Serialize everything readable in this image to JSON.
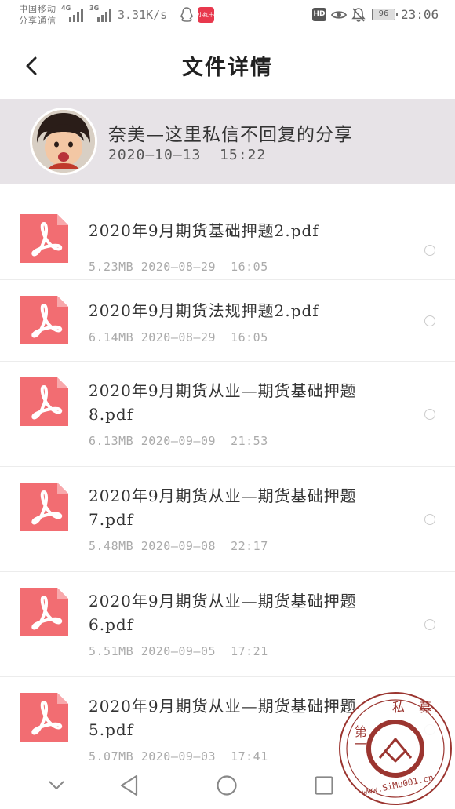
{
  "status_bar": {
    "carrier_line1": "中国移动",
    "carrier_line2": "分享通信",
    "net1": "4G",
    "net2": "3G",
    "speed": "3.31K/s",
    "app_badge": "小红书",
    "hd": "HD",
    "battery": "96",
    "time": "23:06"
  },
  "header": {
    "title": "文件详情"
  },
  "sharer": {
    "name": "奈美—这里私信不回复的分享",
    "time": "2020—10—13  15:22"
  },
  "files": [
    {
      "name": "2020年9月期货基础押题2.pdf",
      "meta": "5.23MB 2020—08—29  16:05"
    },
    {
      "name": "2020年9月期货法规押题2.pdf",
      "meta": "6.14MB 2020—08—29  16:05"
    },
    {
      "name": "2020年9月期货从业—期货基础押题8.pdf",
      "meta": "6.13MB 2020—09—09  21:53"
    },
    {
      "name": "2020年9月期货从业—期货基础押题7.pdf",
      "meta": "5.48MB 2020—09—08  22:17"
    },
    {
      "name": "2020年9月期货从业—期货基础押题6.pdf",
      "meta": "5.51MB 2020—09—05  17:21"
    },
    {
      "name": "2020年9月期货从业—期货基础押题5.pdf",
      "meta": "5.07MB 2020—09—03  17:41"
    }
  ],
  "watermark": {
    "top_text": "私募",
    "left_text": "第一",
    "url": "www.SiMu001.cn"
  },
  "colors": {
    "pdf_icon": "#f26d72",
    "sharer_bg": "#e7e3e7",
    "watermark": "#9b3530"
  }
}
